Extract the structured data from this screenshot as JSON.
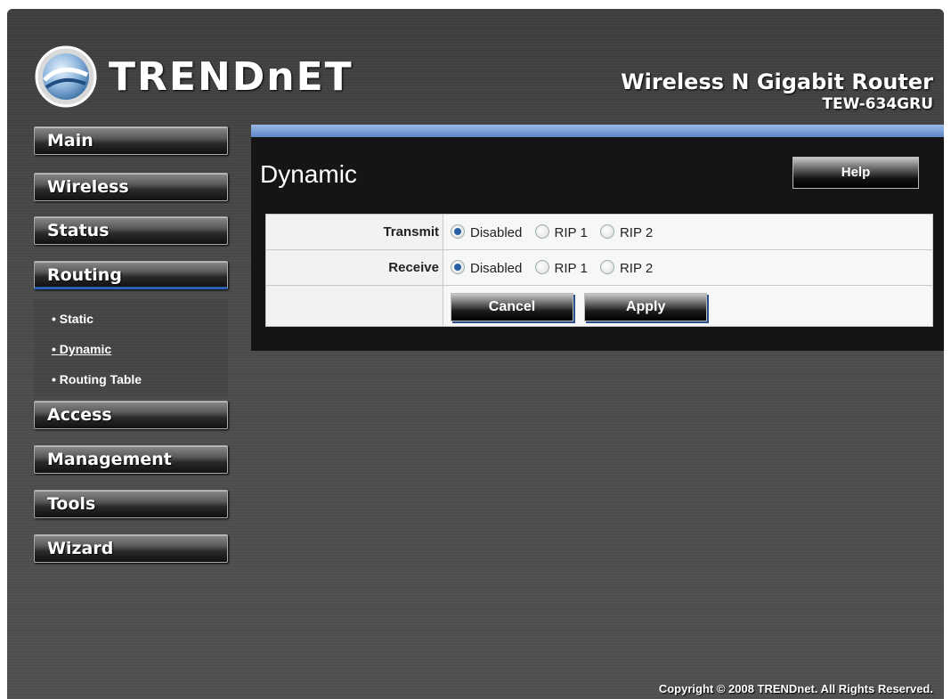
{
  "header": {
    "logo_text": "TRENDnET",
    "product_title": "Wireless N Gigabit Router",
    "product_model": "TEW-634GRU"
  },
  "sidebar": {
    "items": [
      {
        "label": "Main"
      },
      {
        "label": "Wireless"
      },
      {
        "label": "Status"
      },
      {
        "label": "Routing"
      },
      {
        "label": "Access"
      },
      {
        "label": "Management"
      },
      {
        "label": "Tools"
      },
      {
        "label": "Wizard"
      }
    ],
    "active": "Routing",
    "sub_items": [
      {
        "label": "• Static"
      },
      {
        "label": "• Dynamic"
      },
      {
        "label": "• Routing Table"
      }
    ],
    "current_sub": "Dynamic"
  },
  "main": {
    "title": "Dynamic",
    "help_label": "Help",
    "rows": [
      {
        "label": "Transmit",
        "options": [
          "Disabled",
          "RIP 1",
          "RIP 2"
        ],
        "selected": "Disabled"
      },
      {
        "label": "Receive",
        "options": [
          "Disabled",
          "RIP 1",
          "RIP 2"
        ],
        "selected": "Disabled"
      }
    ],
    "cancel_label": "Cancel",
    "apply_label": "Apply"
  },
  "footer": {
    "copyright": "Copyright © 2008 TRENDnet. All Rights Reserved."
  },
  "colors": {
    "accent": "#2a5fb5",
    "background": "#4a4a4a",
    "panel": "#151515"
  }
}
